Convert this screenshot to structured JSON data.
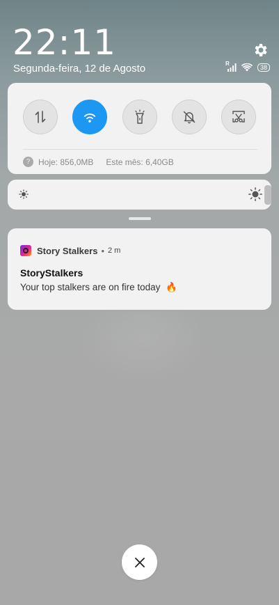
{
  "status": {
    "clock": "22:11",
    "date": "Segunda-feira, 12 de Agosto",
    "signal_label": "R",
    "battery": "38"
  },
  "quick_settings": {
    "toggles": [
      {
        "name": "mobile-data",
        "icon": "data-arrows-icon",
        "active": false
      },
      {
        "name": "wifi",
        "icon": "wifi-icon",
        "active": true
      },
      {
        "name": "flashlight",
        "icon": "flashlight-icon",
        "active": false
      },
      {
        "name": "mute",
        "icon": "bell-off-icon",
        "active": false
      },
      {
        "name": "screenshot",
        "icon": "scissors-icon",
        "active": false
      }
    ],
    "usage_today": "Hoje: 856,0MB",
    "usage_month": "Este mês: 6,40GB",
    "usage_help_glyph": "?"
  },
  "brightness": {
    "level": 1.0
  },
  "notification": {
    "app_name": "Story Stalkers",
    "separator": "•",
    "time": "2 m",
    "title": "StoryStalkers",
    "text": "Your top stalkers are on fire today",
    "emoji": "🔥"
  },
  "colors": {
    "accent": "#1c97f2",
    "card": "#f2f2f2"
  }
}
